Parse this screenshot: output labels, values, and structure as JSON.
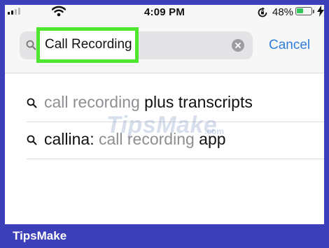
{
  "status_bar": {
    "time": "4:09 PM",
    "battery_percent": "48%",
    "battery_level": 0.48,
    "icons": [
      "cellular-signal-icon",
      "wifi-icon",
      "orientation-lock-icon",
      "battery-icon",
      "charging-bolt-icon"
    ]
  },
  "search": {
    "value": "Call Recording",
    "cancel_label": "Cancel",
    "icons": [
      "search-icon",
      "clear-icon"
    ],
    "highlight_color": "#4ee62e"
  },
  "suggestions": [
    {
      "typed": "call recording",
      "completion": " plus transcripts"
    },
    {
      "typed": "callina: ",
      "middle": "call recording",
      "completion": " app"
    }
  ],
  "watermark": {
    "text": "TipsMake",
    "suffix": ".com"
  },
  "footer": {
    "brand": "TipsMake",
    "color": "#3b40b8"
  },
  "colors": {
    "accent": "#2f7ddb",
    "suggestion_grey": "#8e8e93"
  }
}
